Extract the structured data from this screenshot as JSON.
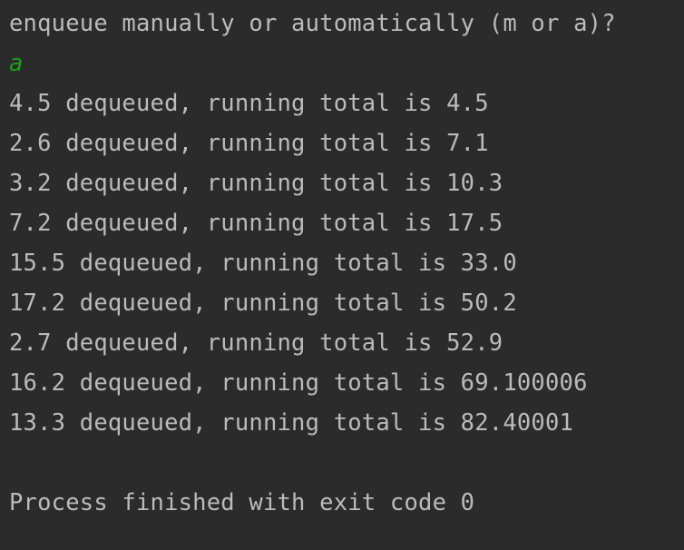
{
  "console": {
    "prompt": "enqueue manually or automatically (m or a)?",
    "user_input": "a",
    "output_lines": [
      "4.5 dequeued, running total is 4.5",
      "2.6 dequeued, running total is 7.1",
      "3.2 dequeued, running total is 10.3",
      "7.2 dequeued, running total is 17.5",
      "15.5 dequeued, running total is 33.0",
      "17.2 dequeued, running total is 50.2",
      "2.7 dequeued, running total is 52.9",
      "16.2 dequeued, running total is 69.100006",
      "13.3 dequeued, running total is 82.40001"
    ],
    "exit_message": "Process finished with exit code 0",
    "colors": {
      "background": "#2b2b2b",
      "text": "#bbbbbb",
      "input": "#1b9e1b"
    }
  }
}
